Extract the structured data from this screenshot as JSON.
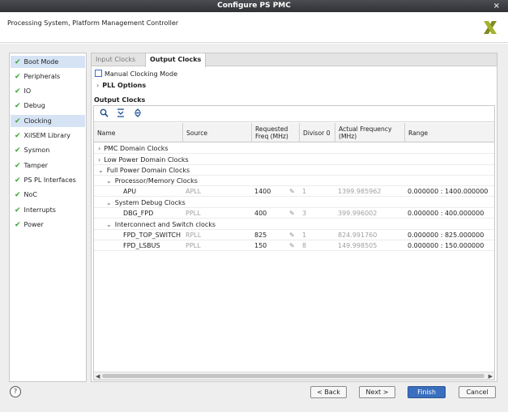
{
  "window": {
    "title": "Configure PS PMC",
    "close_glyph": "×"
  },
  "header": {
    "subtitle": "Processing System, Platform Management Controller",
    "logo_icon": "xilinx-logo"
  },
  "sidebar": {
    "check_glyph": "✔",
    "items": [
      {
        "label": "Boot Mode",
        "selected": true
      },
      {
        "label": "Peripherals"
      },
      {
        "label": "IO"
      },
      {
        "label": "Debug"
      },
      {
        "label": "Clocking",
        "selected": true
      },
      {
        "label": "XilSEM Library"
      },
      {
        "label": "Sysmon"
      },
      {
        "label": "Tamper"
      },
      {
        "label": "PS PL Interfaces"
      },
      {
        "label": "NoC"
      },
      {
        "label": "Interrupts"
      },
      {
        "label": "Power"
      }
    ]
  },
  "tabs": {
    "input": "Input Clocks",
    "output": "Output Clocks",
    "active": "output"
  },
  "manual_clocking": {
    "label": "Manual Clocking Mode",
    "checked": false
  },
  "pll_options": {
    "label": "PLL Options",
    "caret": "›"
  },
  "output_clocks": {
    "section_title": "Output Clocks",
    "toolbar": {
      "search_glyph": "🔍",
      "collapse_glyph": "⇟",
      "expand_glyph": "⇞"
    },
    "columns": {
      "name": "Name",
      "source": "Source",
      "requested_line1": "Requested",
      "requested_line2": "Freq (MHz)",
      "divisor": "Divisor 0",
      "actual_line1": "Actual Frequency",
      "actual_line2": "(MHz)",
      "range": "Range"
    },
    "caret_collapsed": "›",
    "caret_expanded": "⌄",
    "pencil_glyph": "✎",
    "rows": {
      "pmc": "PMC Domain Clocks",
      "lpd": "Low Power Domain Clocks",
      "fpd": "Full Power Domain Clocks",
      "proc_mem": "Processor/Memory Clocks",
      "apu": {
        "name": "APU",
        "source": "APLL",
        "requested": "1400",
        "divisor": "1",
        "actual": "1399.985962",
        "range": "0.000000 : 1400.000000"
      },
      "sys_debug": "System Debug Clocks",
      "dbg_fpd": {
        "name": "DBG_FPD",
        "source": "PPLL",
        "requested": "400",
        "divisor": "3",
        "actual": "399.996002",
        "range": "0.000000 : 400.000000"
      },
      "interconnect": "Interconnect and Switch clocks",
      "fpd_top_switch": {
        "name": "FPD_TOP_SWITCH",
        "source": "RPLL",
        "requested": "825",
        "divisor": "1",
        "actual": "824.991760",
        "range": "0.000000 : 825.000000"
      },
      "fpd_lsbus": {
        "name": "FPD_LSBUS",
        "source": "PPLL",
        "requested": "150",
        "divisor": "8",
        "actual": "149.998505",
        "range": "0.000000 : 150.000000"
      }
    },
    "scroll_left": "◀",
    "scroll_right": "▶"
  },
  "footer": {
    "help": "?",
    "back": "< Back",
    "next": "Next >",
    "finish": "Finish",
    "cancel": "Cancel"
  },
  "colors": {
    "accent": "#3a6fbf",
    "check": "#3aa335",
    "selection": "#d5e3f5"
  }
}
